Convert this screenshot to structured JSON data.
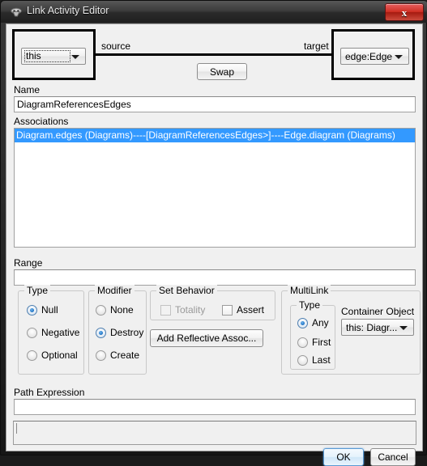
{
  "window": {
    "title": "Link Activity Editor",
    "icon": "app-icon",
    "close_label": "x"
  },
  "link": {
    "source_label": "source",
    "target_label": "target",
    "source_value": "this",
    "target_value": "edge:Edge",
    "swap_label": "Swap"
  },
  "name": {
    "label": "Name",
    "value": "DiagramReferencesEdges",
    "placeholder": ""
  },
  "associations": {
    "label": "Associations",
    "rows": [
      {
        "text": "Diagram.edges (Diagrams)----[DiagramReferencesEdges>]----Edge.diagram (Diagrams)",
        "selected": true
      }
    ]
  },
  "range": {
    "label": "Range",
    "value": "",
    "placeholder": ""
  },
  "type_group": {
    "title": "Type",
    "options": [
      {
        "label": "Null",
        "checked": true
      },
      {
        "label": "Negative",
        "checked": false
      },
      {
        "label": "Optional",
        "checked": false
      }
    ]
  },
  "modifier_group": {
    "title": "Modifier",
    "options": [
      {
        "label": "None",
        "checked": false
      },
      {
        "label": "Destroy",
        "checked": true
      },
      {
        "label": "Create",
        "checked": false
      }
    ]
  },
  "set_behavior": {
    "title": "Set Behavior",
    "totality": {
      "label": "Totality",
      "checked": false,
      "disabled": true
    },
    "assert": {
      "label": "Assert",
      "checked": false,
      "disabled": false
    },
    "add_reflective_label": "Add Reflective Assoc..."
  },
  "multilink": {
    "title": "MultiLink",
    "type_title": "Type",
    "type_options": [
      {
        "label": "Any",
        "checked": true
      },
      {
        "label": "First",
        "checked": false
      },
      {
        "label": "Last",
        "checked": false
      }
    ],
    "container_label": "Container Object",
    "container_value": "this: Diagr..."
  },
  "path_expression": {
    "label": "Path Expression",
    "value": "",
    "placeholder": ""
  },
  "status": {
    "text": ""
  },
  "buttons": {
    "ok": "OK",
    "cancel": "Cancel"
  },
  "colors": {
    "selection": "#3399ff",
    "close_button": "#d03024",
    "default_button_border": "#5a9ad4"
  }
}
